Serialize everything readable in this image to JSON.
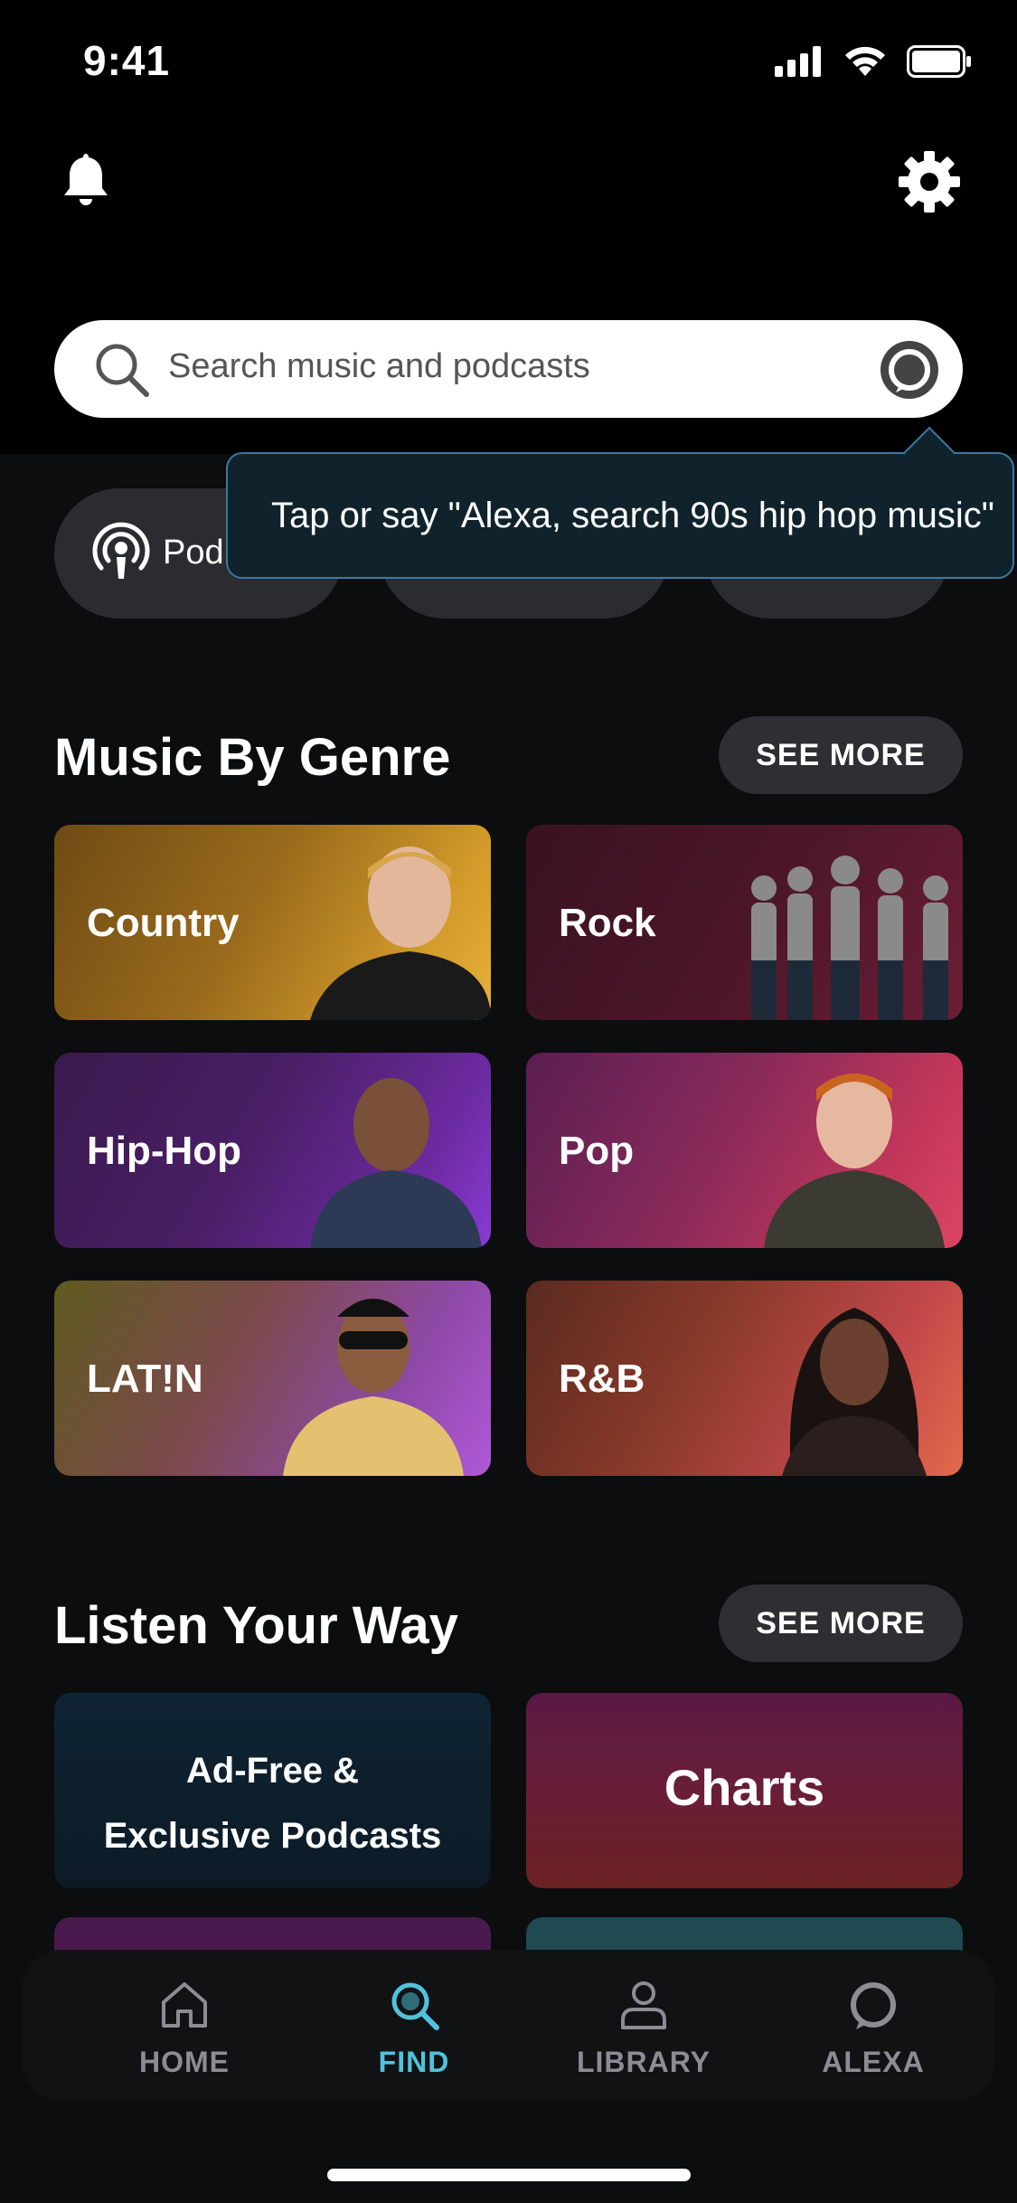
{
  "status_bar": {
    "time": "9:41"
  },
  "search": {
    "placeholder": "Search music and podcasts"
  },
  "chips": [
    {
      "label": "Pod",
      "icon": "podcast-icon"
    },
    {
      "label": ""
    },
    {
      "label": ""
    }
  ],
  "tooltip": {
    "text": "Tap or say \"Alexa, search 90s hip hop music\""
  },
  "genre_section": {
    "title": "Music By Genre",
    "see_more": "SEE MORE",
    "tiles": [
      {
        "label": "Country"
      },
      {
        "label": "Rock"
      },
      {
        "label": "Hip-Hop"
      },
      {
        "label": "Pop"
      },
      {
        "label": "LAT!N"
      },
      {
        "label": "R&B"
      }
    ]
  },
  "listen_section": {
    "title": "Listen Your Way",
    "see_more": "SEE MORE",
    "tiles": [
      {
        "label_line1": "Ad-Free &",
        "label_line2": "Exclusive Podcasts"
      },
      {
        "label": "Charts"
      }
    ]
  },
  "nav": {
    "items": [
      {
        "label": "HOME",
        "icon": "home-icon"
      },
      {
        "label": "FIND",
        "icon": "search-icon",
        "active": true
      },
      {
        "label": "LIBRARY",
        "icon": "person-icon"
      },
      {
        "label": "ALEXA",
        "icon": "alexa-icon"
      }
    ]
  },
  "colors": {
    "accent": "#4fc3dc",
    "background": "#0c0d0f",
    "tooltip_border": "#3b7aa0"
  }
}
